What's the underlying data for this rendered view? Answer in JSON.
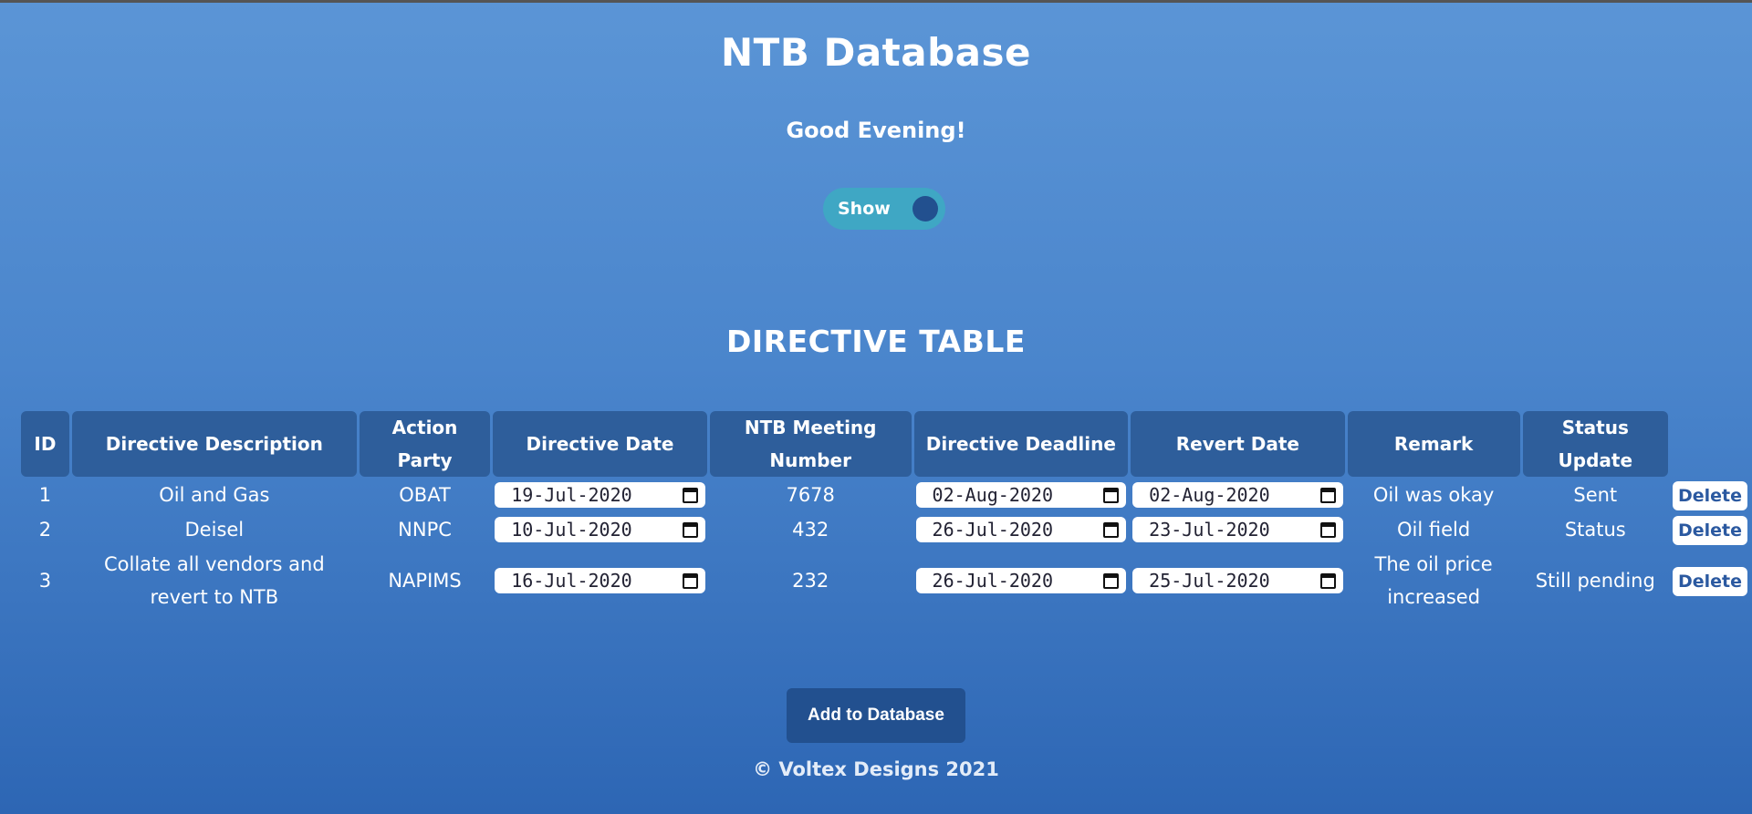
{
  "header": {
    "title": "NTB Database",
    "greeting": "Good Evening!"
  },
  "toggle": {
    "label": "Show"
  },
  "section_title": "DIRECTIVE TABLE",
  "table": {
    "columns": [
      "ID",
      "Directive Description",
      "Action Party",
      "Directive Date",
      "NTB Meeting Number",
      "Directive Deadline",
      "Revert Date",
      "Remark",
      "Status Update"
    ],
    "rows": [
      {
        "id": "1",
        "description": "Oil and Gas",
        "action_party": "OBAT",
        "directive_date": "19-Jul-2020",
        "meeting_number": "7678",
        "deadline": "02-Aug-2020",
        "revert_date": "02-Aug-2020",
        "remark": "Oil was okay",
        "status": "Sent",
        "delete_label": "Delete"
      },
      {
        "id": "2",
        "description": "Deisel",
        "action_party": "NNPC",
        "directive_date": "10-Jul-2020",
        "meeting_number": "432",
        "deadline": "26-Jul-2020",
        "revert_date": "23-Jul-2020",
        "remark": "Oil field",
        "status": "Status",
        "delete_label": "Delete"
      },
      {
        "id": "3",
        "description": "Collate all vendors and revert to NTB",
        "action_party": "NAPIMS",
        "directive_date": "16-Jul-2020",
        "meeting_number": "232",
        "deadline": "26-Jul-2020",
        "revert_date": "25-Jul-2020",
        "remark": "The oil price increased",
        "status": "Still pending",
        "delete_label": "Delete"
      }
    ]
  },
  "actions": {
    "add_label": "Add to Database"
  },
  "footer": {
    "text": "© Voltex Designs 2021"
  },
  "colors": {
    "background_top": "#5b95d6",
    "background_bottom": "#2d66b4",
    "header_cell": "#2e5e9b",
    "toggle_track": "#3fa7c4",
    "toggle_knob": "#22508f",
    "primary_button": "#22508f",
    "delete_text": "#2b59a0"
  },
  "icons": {
    "date_picker": "calendar-icon"
  }
}
